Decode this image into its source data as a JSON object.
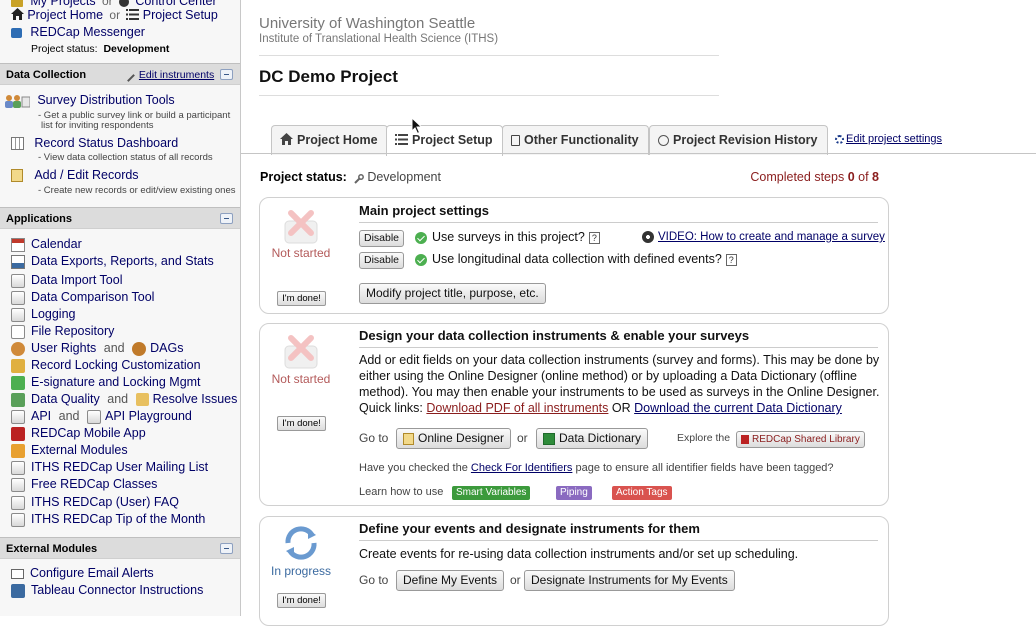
{
  "sidebar": {
    "top_links": {
      "my_projects": "My Projects",
      "or1": "or",
      "control_center": "Control Center",
      "project_home": "Project Home",
      "or2": "or",
      "project_setup": "Project Setup",
      "messenger": "REDCap Messenger",
      "status_label": "Project status:",
      "status_value": "Development"
    },
    "data_collection": {
      "header": "Data Collection",
      "edit_instruments": "Edit instruments",
      "items": [
        {
          "label": "Survey Distribution Tools",
          "sub1": "- Get a public survey link or build a participant",
          "sub2": "list for inviting respondents"
        },
        {
          "label": "Record Status Dashboard",
          "sub1": "- View data collection status of all records"
        },
        {
          "label": "Add / Edit Records",
          "sub1": "- Create new records or edit/view existing ones"
        }
      ]
    },
    "applications": {
      "header": "Applications",
      "items": [
        {
          "label": "Calendar"
        },
        {
          "label": "Data Exports, Reports, and Stats"
        },
        {
          "label": "Data Import Tool"
        },
        {
          "label": "Data Comparison Tool"
        },
        {
          "label": "Logging"
        },
        {
          "label": "File Repository"
        },
        {
          "label": "User Rights",
          "and": "and",
          "label2": "DAGs"
        },
        {
          "label": "Record Locking Customization"
        },
        {
          "label": "E-signature and Locking Mgmt"
        },
        {
          "label": "Data Quality",
          "and": "and",
          "label2": "Resolve Issues"
        },
        {
          "label": "API",
          "and": "and",
          "label2": "API Playground"
        },
        {
          "label": "REDCap Mobile App"
        },
        {
          "label": "External Modules"
        },
        {
          "label": "ITHS REDCap User Mailing List"
        },
        {
          "label": "Free REDCap Classes"
        },
        {
          "label": "ITHS REDCap (User) FAQ"
        },
        {
          "label": "ITHS REDCap Tip of the Month"
        }
      ]
    },
    "external_modules": {
      "header": "External Modules",
      "items": [
        {
          "label": "Configure Email Alerts"
        },
        {
          "label": "Tableau Connector Instructions"
        }
      ]
    }
  },
  "header": {
    "institution": "University of Washington Seattle",
    "institute": "Institute of Translational Health Science (ITHS)",
    "project_title": "DC Demo Project"
  },
  "tabs": [
    {
      "label": "Project Home",
      "icon": "house-icon"
    },
    {
      "label": "Project Setup",
      "icon": "list-icon",
      "active": true
    },
    {
      "label": "Other Functionality",
      "icon": "clipboard-icon"
    },
    {
      "label": "Project Revision History",
      "icon": "history-icon"
    }
  ],
  "edit_settings": "Edit project settings",
  "status": {
    "label": "Project status:",
    "value": "Development",
    "completed_prefix": "Completed steps",
    "completed_done": "0",
    "completed_of": "of",
    "completed_total": "8"
  },
  "steps": {
    "s1": {
      "status": "Not started",
      "done_label": "I'm done!",
      "title": "Main project settings",
      "disable1": "Disable",
      "option1": "Use surveys in this project?",
      "disable2": "Disable",
      "option2": "Use longitudinal data collection with defined events?",
      "video": "VIDEO: How to create and manage a survey",
      "modify": "Modify project title, purpose, etc."
    },
    "s2": {
      "status": "Not started",
      "done_label": "I'm done!",
      "title": "Design your data collection instruments & enable your surveys",
      "desc1": "Add or edit fields on your data collection instruments (survey and forms). This may be done by",
      "desc2": "either using the Online Designer (online method) or by uploading a Data Dictionary (offline",
      "desc3": "method). You may then enable your instruments to be used as surveys in the Online Designer.",
      "quick": "Quick links:",
      "pdf_link": "Download PDF of all instruments",
      "or": "OR",
      "dd_link": "Download the current Data Dictionary",
      "goto": "Go to",
      "online_designer": "Online Designer",
      "or2": "or",
      "data_dictionary": "Data Dictionary",
      "explore": "Explore the",
      "shared_library": "REDCap Shared Library",
      "check_pre": "Have you checked the",
      "check_link": "Check For Identifiers",
      "check_post": "page to ensure all identifier fields have been tagged?",
      "learn": "Learn how to use",
      "smart_vars": "Smart Variables",
      "piping": "Piping",
      "action_tags": "Action Tags",
      "colors": {
        "smart": "#3c9a3c",
        "piping": "#8a6ac0",
        "action": "#d9534f"
      }
    },
    "s3": {
      "status": "In progress",
      "done_label": "I'm done!",
      "title": "Define your events and designate instruments for them",
      "desc": "Create events for re-using data collection instruments and/or set up scheduling.",
      "goto": "Go to",
      "define": "Define My Events",
      "or": "or",
      "designate": "Designate Instruments for My Events"
    }
  }
}
